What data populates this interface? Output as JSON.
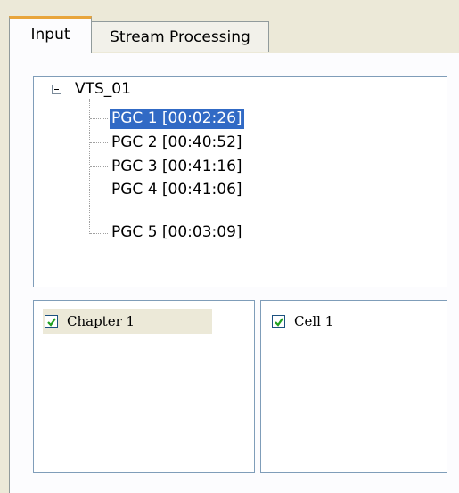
{
  "tabs": [
    {
      "label": "Input",
      "active": true
    },
    {
      "label": "Stream Processing",
      "active": false
    }
  ],
  "tree": {
    "root": {
      "label": "VTS_01",
      "expanded": true
    },
    "items": [
      {
        "label": "PGC 1 [00:02:26]",
        "selected": true
      },
      {
        "label": "PGC 2 [00:40:52]",
        "selected": false
      },
      {
        "label": "PGC 3 [00:41:16]",
        "selected": false
      },
      {
        "label": "PGC 4 [00:41:06]",
        "selected": false
      },
      {
        "label": "PGC 5 [00:03:09]",
        "selected": false
      }
    ]
  },
  "chapters": [
    {
      "label": "Chapter 1",
      "checked": true
    }
  ],
  "cells": [
    {
      "label": "Cell 1",
      "checked": true
    }
  ],
  "colors": {
    "selection": "#316ac5",
    "check": "#21a121",
    "tab_accent": "#e8a53c"
  },
  "icons": {
    "tree_toggle": "minus-box-icon",
    "check": "checkmark-icon"
  }
}
